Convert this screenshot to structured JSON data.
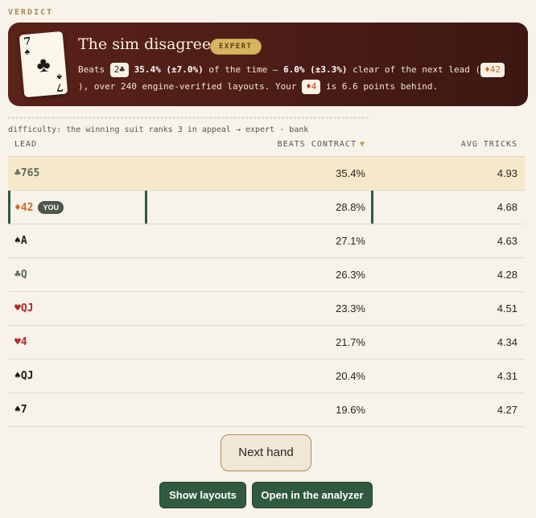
{
  "verdict_label": "VERDICT",
  "card": {
    "rank": "7",
    "suit": "♣"
  },
  "headline": "The sim disagrees.",
  "level_badge": "EXPERT",
  "summary": {
    "beats_word": "Beats",
    "chip_best": "2♣",
    "pct": "35.4% (±7.0%)",
    "text1": "of the time — ",
    "clear": "6.0% (±3.3%)",
    "text2": "clear of the next lead (",
    "chip_next": "♦42",
    "text3": "), over 240 engine-verified layouts. Your",
    "chip_yours": "♦4",
    "text4": "is 6.6 points behind."
  },
  "difficulty": "difficulty: the winning suit ranks 3 in appeal → expert · bank",
  "table": {
    "headers": {
      "lead": "LEAD",
      "beats": "BEATS CONTRACT",
      "beats_arrow": "▼",
      "avg": "AVG TRICKS"
    },
    "you_label": "YOU",
    "rows": [
      {
        "lead": "♣765",
        "beats": "35.4%",
        "avg": "4.93"
      },
      {
        "lead": "♦42",
        "beats": "28.8%",
        "avg": "4.68"
      },
      {
        "lead": "♠A",
        "beats": "27.1%",
        "avg": "4.63"
      },
      {
        "lead": "♣Q",
        "beats": "26.3%",
        "avg": "4.28"
      },
      {
        "lead": "♥QJ",
        "beats": "23.3%",
        "avg": "4.51"
      },
      {
        "lead": "♥4",
        "beats": "21.7%",
        "avg": "4.34"
      },
      {
        "lead": "♠QJ",
        "beats": "20.4%",
        "avg": "4.31"
      },
      {
        "lead": "♠7",
        "beats": "19.6%",
        "avg": "4.27"
      }
    ]
  },
  "buttons": {
    "next_hand": "Next hand",
    "show_layouts": "Show layouts",
    "open_analyzer": "Open in the analyzer"
  },
  "colors": {
    "banner": "#4a1c16",
    "accent_gold": "#d6b561",
    "green": "#2f5a3e",
    "best_row": "#f6e9c9"
  }
}
